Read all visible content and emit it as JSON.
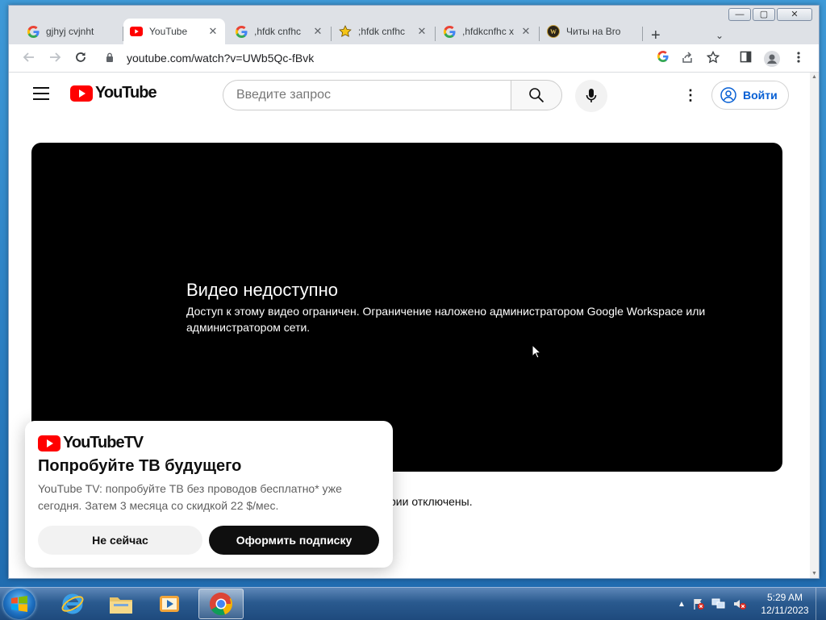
{
  "browser": {
    "window_controls": {
      "minimize": "—",
      "maximize": "▢",
      "close": "✕"
    },
    "tabs": [
      {
        "title": "gjhyj cvjnht",
        "icon": "google-icon",
        "active": false
      },
      {
        "title": "YouTube",
        "icon": "youtube-icon",
        "active": true
      },
      {
        "title": ",hfdk cnfhc",
        "icon": "google-icon",
        "active": false
      },
      {
        "title": ";hfdk cnfhc",
        "icon": "star-icon",
        "active": false
      },
      {
        "title": ",hfdkcnfhc x",
        "icon": "google-icon",
        "active": false
      },
      {
        "title": "Читы на Bro",
        "icon": "wow-icon",
        "active": false
      }
    ],
    "new_tab_label": "+",
    "tab_search_label": "⌄",
    "url": "youtube.com/watch?v=UWb5Qc-fBvk"
  },
  "youtube": {
    "logo_text": "YouTube",
    "search_placeholder": "Введите запрос",
    "signin_label": "Войти",
    "brand_red": "#ff0000",
    "link_blue": "#065fd4"
  },
  "player": {
    "error_title": "Видео недоступно",
    "error_description": "Доступ к этому видео ограничен. Ограничение наложено администратором Google Workspace или администратором сети."
  },
  "below_player": {
    "comments_note": "рии отключены."
  },
  "promo": {
    "logo_text": "YouTubeTV",
    "title": "Попробуйте ТВ будущего",
    "text": "YouTube TV: попробуйте ТВ без проводов бесплатно* уже сегодня. Затем 3 месяца со скидкой 22 $/мес.",
    "later_button": "Не сейчас",
    "subscribe_button": "Оформить подписку"
  },
  "taskbar": {
    "apps": [
      {
        "name": "internet-explorer-icon",
        "active": false
      },
      {
        "name": "file-explorer-icon",
        "active": false
      },
      {
        "name": "media-player-icon",
        "active": false
      },
      {
        "name": "chrome-icon",
        "active": true
      }
    ],
    "tray_arrow": "▲",
    "time": "5:29 AM",
    "date": "12/11/2023"
  }
}
